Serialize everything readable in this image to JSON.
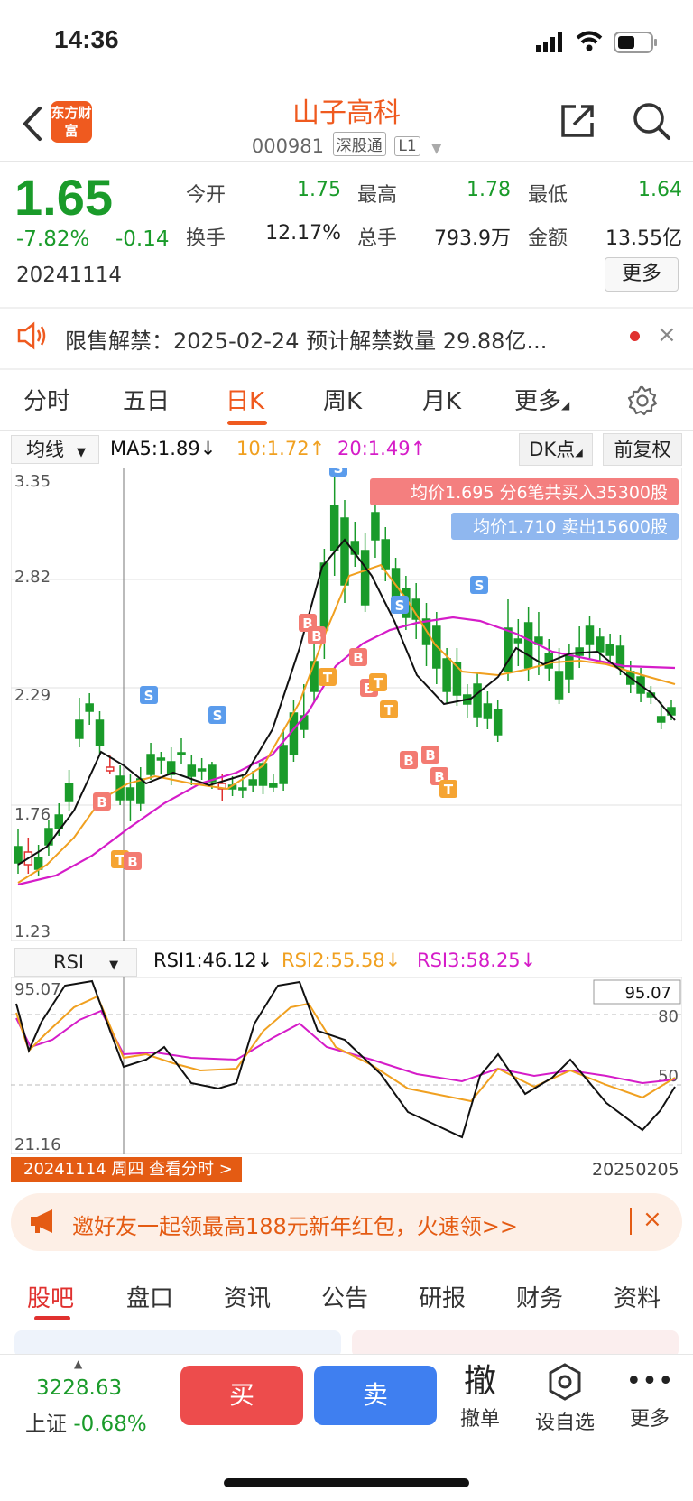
{
  "status_bar": {
    "time": "14:36"
  },
  "header": {
    "logo_text": "东方财富",
    "stock_name": "山子高科",
    "stock_code": "000981",
    "tags": [
      "深股通",
      "L1"
    ]
  },
  "quote": {
    "price": "1.65",
    "change_pct": "-7.82%",
    "change": "-0.14",
    "date": "20241114",
    "fields": [
      {
        "label": "今开",
        "value": "1.75",
        "color": "green"
      },
      {
        "label": "最高",
        "value": "1.78",
        "color": "green"
      },
      {
        "label": "最低",
        "value": "1.64",
        "color": "green"
      },
      {
        "label": "换手",
        "value": "12.17%",
        "color": "black"
      },
      {
        "label": "总手",
        "value": "793.9万",
        "color": "black"
      },
      {
        "label": "金额",
        "value": "13.55亿",
        "color": "black"
      }
    ],
    "more_label": "更多"
  },
  "notice": {
    "text": "限售解禁：2025-02-24 预计解禁数量 29.88亿...",
    "close": "×"
  },
  "chart_tabs": [
    "分时",
    "五日",
    "日K",
    "周K",
    "月K",
    "更多"
  ],
  "ma_legend": {
    "selector": "均线",
    "ma5": "MA5:1.89",
    "ma5_arrow": "↓",
    "ma10": "10:1.72",
    "ma10_arrow": "↑",
    "ma20": "20:1.49",
    "ma20_arrow": "↑",
    "dk_label": "DK点",
    "fq_label": "前复权"
  },
  "kline": {
    "y_labels": [
      "3.35",
      "2.82",
      "2.29",
      "1.76",
      "1.23"
    ],
    "buy_note": "均价1.695 分6笔共买入35300股",
    "sell_note": "均价1.710 卖出15600股",
    "marker_letters": {
      "buy": "B",
      "sell": "S",
      "t": "T"
    }
  },
  "rsi": {
    "selector": "RSI",
    "rsi1": "RSI1:46.12",
    "rsi1_arrow": "↓",
    "rsi2": "RSI2:55.58",
    "rsi2_arrow": "↓",
    "rsi3": "RSI3:58.25",
    "rsi3_arrow": "↓",
    "y_top": "95.07",
    "y_bottom": "21.16",
    "level_80": "80",
    "level_50": "50",
    "box_value": "95.07"
  },
  "timeline": {
    "badge": "20241114 周四 查看分时 >",
    "end_date": "20250205"
  },
  "promo": {
    "text": "邀好友一起领最高188元新年红包，火速领>>",
    "close": "×"
  },
  "bottom_tabs": [
    "股吧",
    "盘口",
    "资讯",
    "公告",
    "研报",
    "财务",
    "资料"
  ],
  "bottom_bar": {
    "index_value": "3228.63",
    "index_name": "上证",
    "index_pct": "-0.68%",
    "buy": "买",
    "sell": "卖",
    "cancel_icon": "撤",
    "cancel_label": "撤单",
    "watch_label": "设自选",
    "more_label": "更多"
  },
  "colors": {
    "accent": "#ef5a1f",
    "up": "#e0312f",
    "down": "#1a9b2a",
    "ma5": "#111111",
    "ma10": "#f0a020",
    "ma20": "#d51cc8"
  }
}
